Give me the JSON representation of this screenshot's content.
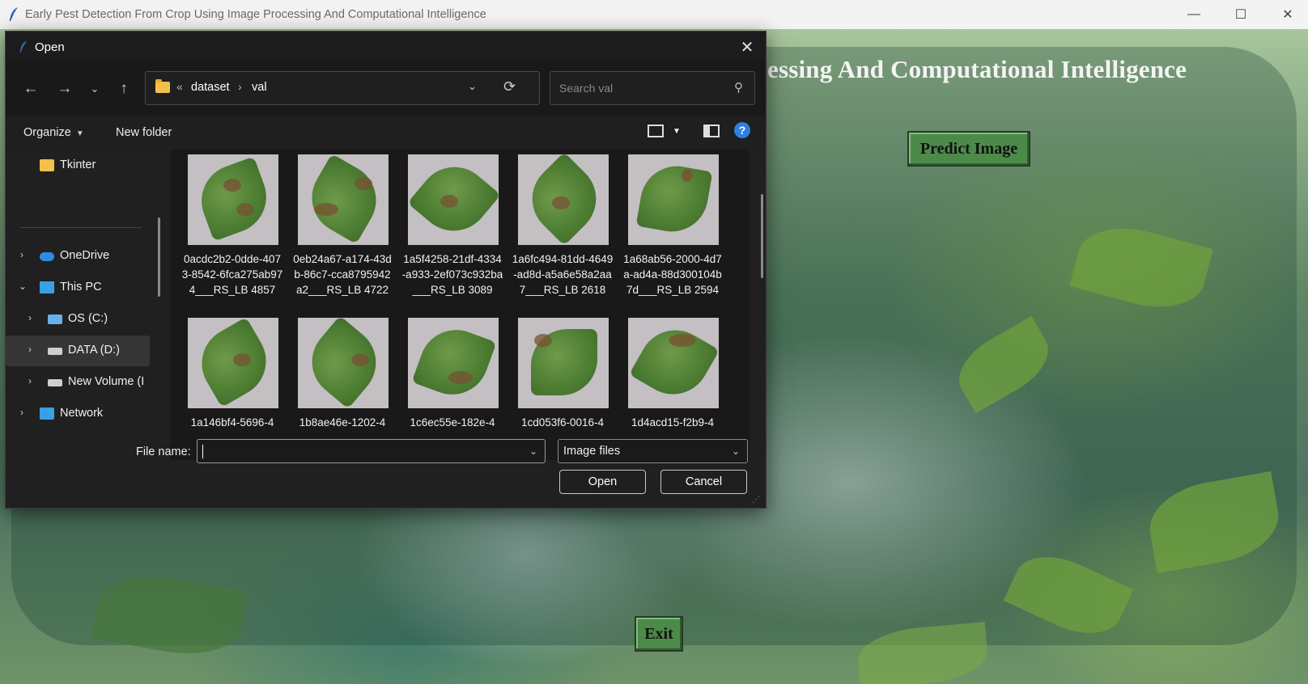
{
  "main_window": {
    "title": "Early Pest Detection From Crop Using Image Processing And Computational Intelligence",
    "minimize": "—",
    "maximize": "☐",
    "close": "✕"
  },
  "app": {
    "heading_visible": "essing And Computational Intelligence",
    "predict_button": "Predict Image",
    "exit_button": "Exit"
  },
  "dialog": {
    "title": "Open",
    "close": "✕",
    "address": {
      "prefix": "«",
      "crumbs": [
        "dataset",
        "val"
      ],
      "separator": "›"
    },
    "search_placeholder": "Search val",
    "toolbar": {
      "organize": "Organize",
      "new_folder": "New folder",
      "help": "?"
    },
    "nav": [
      {
        "label": "Tkinter",
        "icon": "folder-icon",
        "expandable": false
      },
      {
        "label": "OneDrive",
        "icon": "cloud-icon",
        "expandable": true
      },
      {
        "label": "This PC",
        "icon": "computer-icon",
        "expandable": true,
        "expanded": true
      },
      {
        "label": "OS (C:)",
        "icon": "drive-icon",
        "expandable": true
      },
      {
        "label": "DATA (D:)",
        "icon": "drive-icon",
        "expandable": true,
        "selected": true
      },
      {
        "label": "New Volume (I",
        "icon": "drive-icon",
        "expandable": true
      },
      {
        "label": "Network",
        "icon": "network-icon",
        "expandable": true
      }
    ],
    "files": [
      {
        "name": "0acdc2b2-0dde-4073-8542-6fca275ab974___RS_LB 4857"
      },
      {
        "name": "0eb24a67-a174-43db-86c7-cca8795942a2___RS_LB 4722"
      },
      {
        "name": "1a5f4258-21df-4334-a933-2ef073c932ba___RS_LB 3089"
      },
      {
        "name": "1a6fc494-81dd-4649-ad8d-a5a6e58a2aa7___RS_LB 2618"
      },
      {
        "name": "1a68ab56-2000-4d7a-ad4a-88d300104b7d___RS_LB 2594"
      },
      {
        "name": "1a146bf4-5696-4"
      },
      {
        "name": "1b8ae46e-1202-4"
      },
      {
        "name": "1c6ec55e-182e-4"
      },
      {
        "name": "1cd053f6-0016-4"
      },
      {
        "name": "1d4acd15-f2b9-4"
      }
    ],
    "footer": {
      "file_name_label": "File name:",
      "file_name_value": "",
      "filter_value": "Image files",
      "open_button": "Open",
      "cancel_button": "Cancel"
    }
  }
}
